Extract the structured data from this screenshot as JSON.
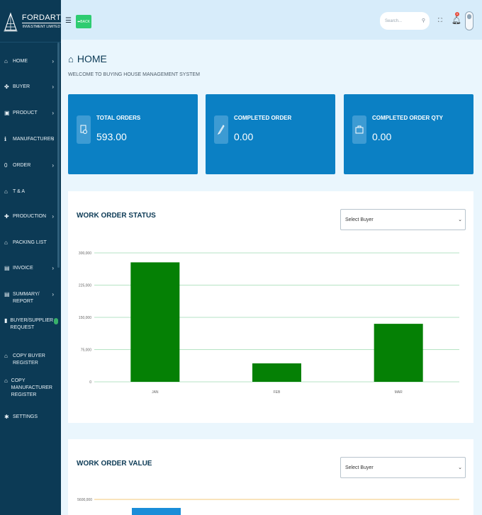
{
  "brand": {
    "name": "FORDART",
    "sub": "INVESTMENT LIMITED"
  },
  "sidebar": {
    "items": [
      {
        "label": "HOME",
        "icon": "home-icon",
        "chevron": true,
        "badge": false
      },
      {
        "label": "BUYER",
        "icon": "users-icon",
        "chevron": true,
        "badge": false
      },
      {
        "label": "PRODUCT",
        "icon": "product-icon",
        "chevron": true,
        "badge": false
      },
      {
        "label": "MANUFACTURER",
        "icon": "info-icon",
        "chevron": true,
        "badge": false
      },
      {
        "label": "ORDER",
        "icon": "order-icon",
        "chevron": true,
        "badge": false
      },
      {
        "label": "T & A",
        "icon": "home-icon",
        "chevron": false,
        "badge": false
      },
      {
        "label": "PRODUCTION",
        "icon": "production-icon",
        "chevron": true,
        "badge": false
      },
      {
        "label": "PACKING LIST",
        "icon": "home-icon",
        "chevron": false,
        "badge": false
      },
      {
        "label": "INVOICE",
        "icon": "invoice-icon",
        "chevron": true,
        "badge": false
      },
      {
        "label": "SUMMARY/ REPORT",
        "icon": "report-icon",
        "chevron": true,
        "badge": false
      },
      {
        "label": "BUYER/SUPPLIER REQUEST",
        "icon": "request-icon",
        "chevron": false,
        "badge": true
      },
      {
        "label": "COPY BUYER REGISTER",
        "icon": "home-icon",
        "chevron": false,
        "badge": false
      },
      {
        "label": "COPY MANUFACTURER REGISTER",
        "icon": "home-icon",
        "chevron": false,
        "badge": false
      },
      {
        "label": "SETTINGS",
        "icon": "gear-icon",
        "chevron": false,
        "badge": false
      }
    ]
  },
  "topbar": {
    "back_label": "BACK",
    "search_placeholder": "Search...",
    "notification_count": "0"
  },
  "page": {
    "title": "HOME",
    "subtitle": "WELCOME TO BUYING HOUSE MANAGEMENT SYSTEM"
  },
  "stats": [
    {
      "label": "TOTAL ORDERS",
      "value": "593.00",
      "icon": "document-clock-icon"
    },
    {
      "label": "COMPLETED ORDER",
      "value": "0.00",
      "icon": "pen-icon"
    },
    {
      "label": "COMPLETED ORDER QTY",
      "value": "0.00",
      "icon": "briefcase-icon"
    }
  ],
  "work_order_status": {
    "title": "WORK ORDER STATUS",
    "select_value": "Select Buyer"
  },
  "work_order_value": {
    "title": "WORK ORDER VALUE",
    "select_value": "Select Buyer",
    "visible_tick": "5600,000"
  },
  "chart_data": {
    "type": "bar",
    "categories": [
      "JAN",
      "FEB",
      "MAR"
    ],
    "values": [
      278000,
      43000,
      135000
    ],
    "ylim": [
      0,
      300000
    ],
    "yticks": [
      0,
      75000,
      150000,
      225000,
      300000
    ],
    "ytick_labels": [
      "0",
      "75,000",
      "150,000",
      "225,000",
      "300,000"
    ],
    "grid": true,
    "bar_color": "#058005",
    "grid_color": "#b6e3c4"
  }
}
